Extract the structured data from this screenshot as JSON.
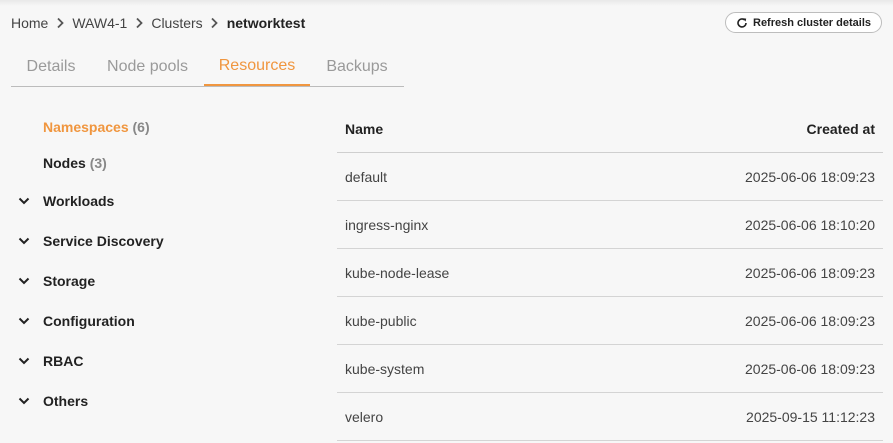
{
  "breadcrumb": {
    "items": [
      "Home",
      "WAW4-1",
      "Clusters"
    ],
    "current": "networktest"
  },
  "refresh_button": {
    "label": "Refresh cluster details",
    "icon": "refresh-icon"
  },
  "tabs": [
    {
      "label": "Details",
      "active": false
    },
    {
      "label": "Node pools",
      "active": false
    },
    {
      "label": "Resources",
      "active": true
    },
    {
      "label": "Backups",
      "active": false
    }
  ],
  "sidebar": {
    "items": [
      {
        "label": "Namespaces",
        "count": "(6)",
        "active": true
      },
      {
        "label": "Nodes",
        "count": "(3)",
        "active": false
      }
    ],
    "groups": [
      {
        "label": "Workloads",
        "icon": "chevron-down-icon"
      },
      {
        "label": "Service Discovery",
        "icon": "chevron-down-icon"
      },
      {
        "label": "Storage",
        "icon": "chevron-down-icon"
      },
      {
        "label": "Configuration",
        "icon": "chevron-down-icon"
      },
      {
        "label": "RBAC",
        "icon": "chevron-down-icon"
      },
      {
        "label": "Others",
        "icon": "chevron-down-icon"
      }
    ]
  },
  "table": {
    "columns": [
      "Name",
      "Created at"
    ],
    "rows": [
      {
        "name": "default",
        "created": "2025-06-06 18:09:23"
      },
      {
        "name": "ingress-nginx",
        "created": "2025-06-06 18:10:20"
      },
      {
        "name": "kube-node-lease",
        "created": "2025-06-06 18:09:23"
      },
      {
        "name": "kube-public",
        "created": "2025-06-06 18:09:23"
      },
      {
        "name": "kube-system",
        "created": "2025-06-06 18:09:23"
      },
      {
        "name": "velero",
        "created": "2025-09-15 11:12:23"
      }
    ]
  },
  "colors": {
    "accent": "#f0963f",
    "muted": "#9a9a9a",
    "background": "#f7f7f7"
  }
}
